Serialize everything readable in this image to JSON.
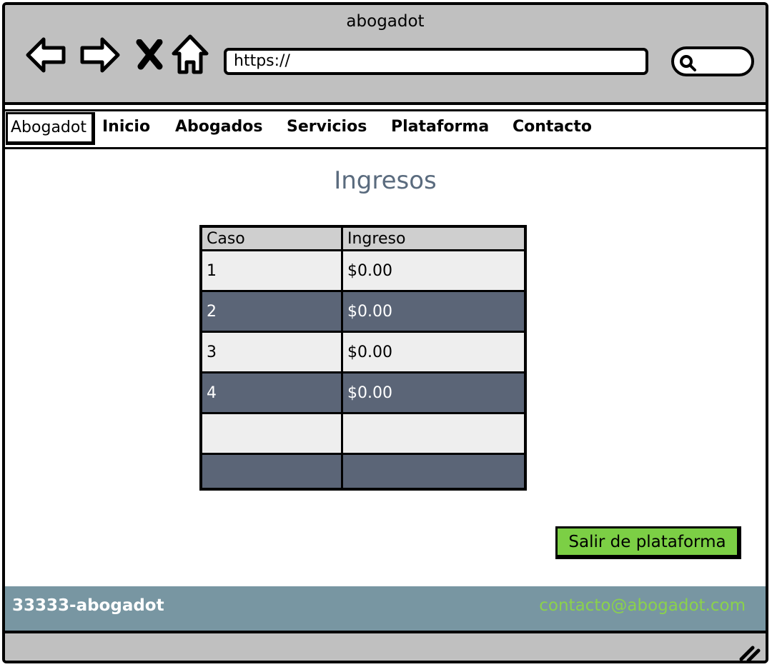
{
  "window": {
    "title": "abogadot"
  },
  "browser": {
    "url": "https://"
  },
  "nav": {
    "brand": "Abogadot",
    "items": [
      "Inicio",
      "Abogados",
      "Servicios",
      "Plataforma",
      "Contacto"
    ]
  },
  "page": {
    "title": "Ingresos"
  },
  "table": {
    "headers": [
      "Caso",
      "Ingreso"
    ],
    "rows": [
      [
        "1",
        "$0.00"
      ],
      [
        "2",
        "$0.00"
      ],
      [
        "3",
        "$0.00"
      ],
      [
        "4",
        "$0.00"
      ],
      [
        "",
        ""
      ],
      [
        "",
        ""
      ]
    ]
  },
  "actions": {
    "exit_label": "Salir de plataforma"
  },
  "footer": {
    "phone": "33333-abogadot",
    "email": "contacto@abogadot.com"
  },
  "colors": {
    "accent_green": "#7ccf45",
    "row_dark": "#5b6577",
    "footer_bg": "#7896a2",
    "email_green": "#8bd24b"
  }
}
